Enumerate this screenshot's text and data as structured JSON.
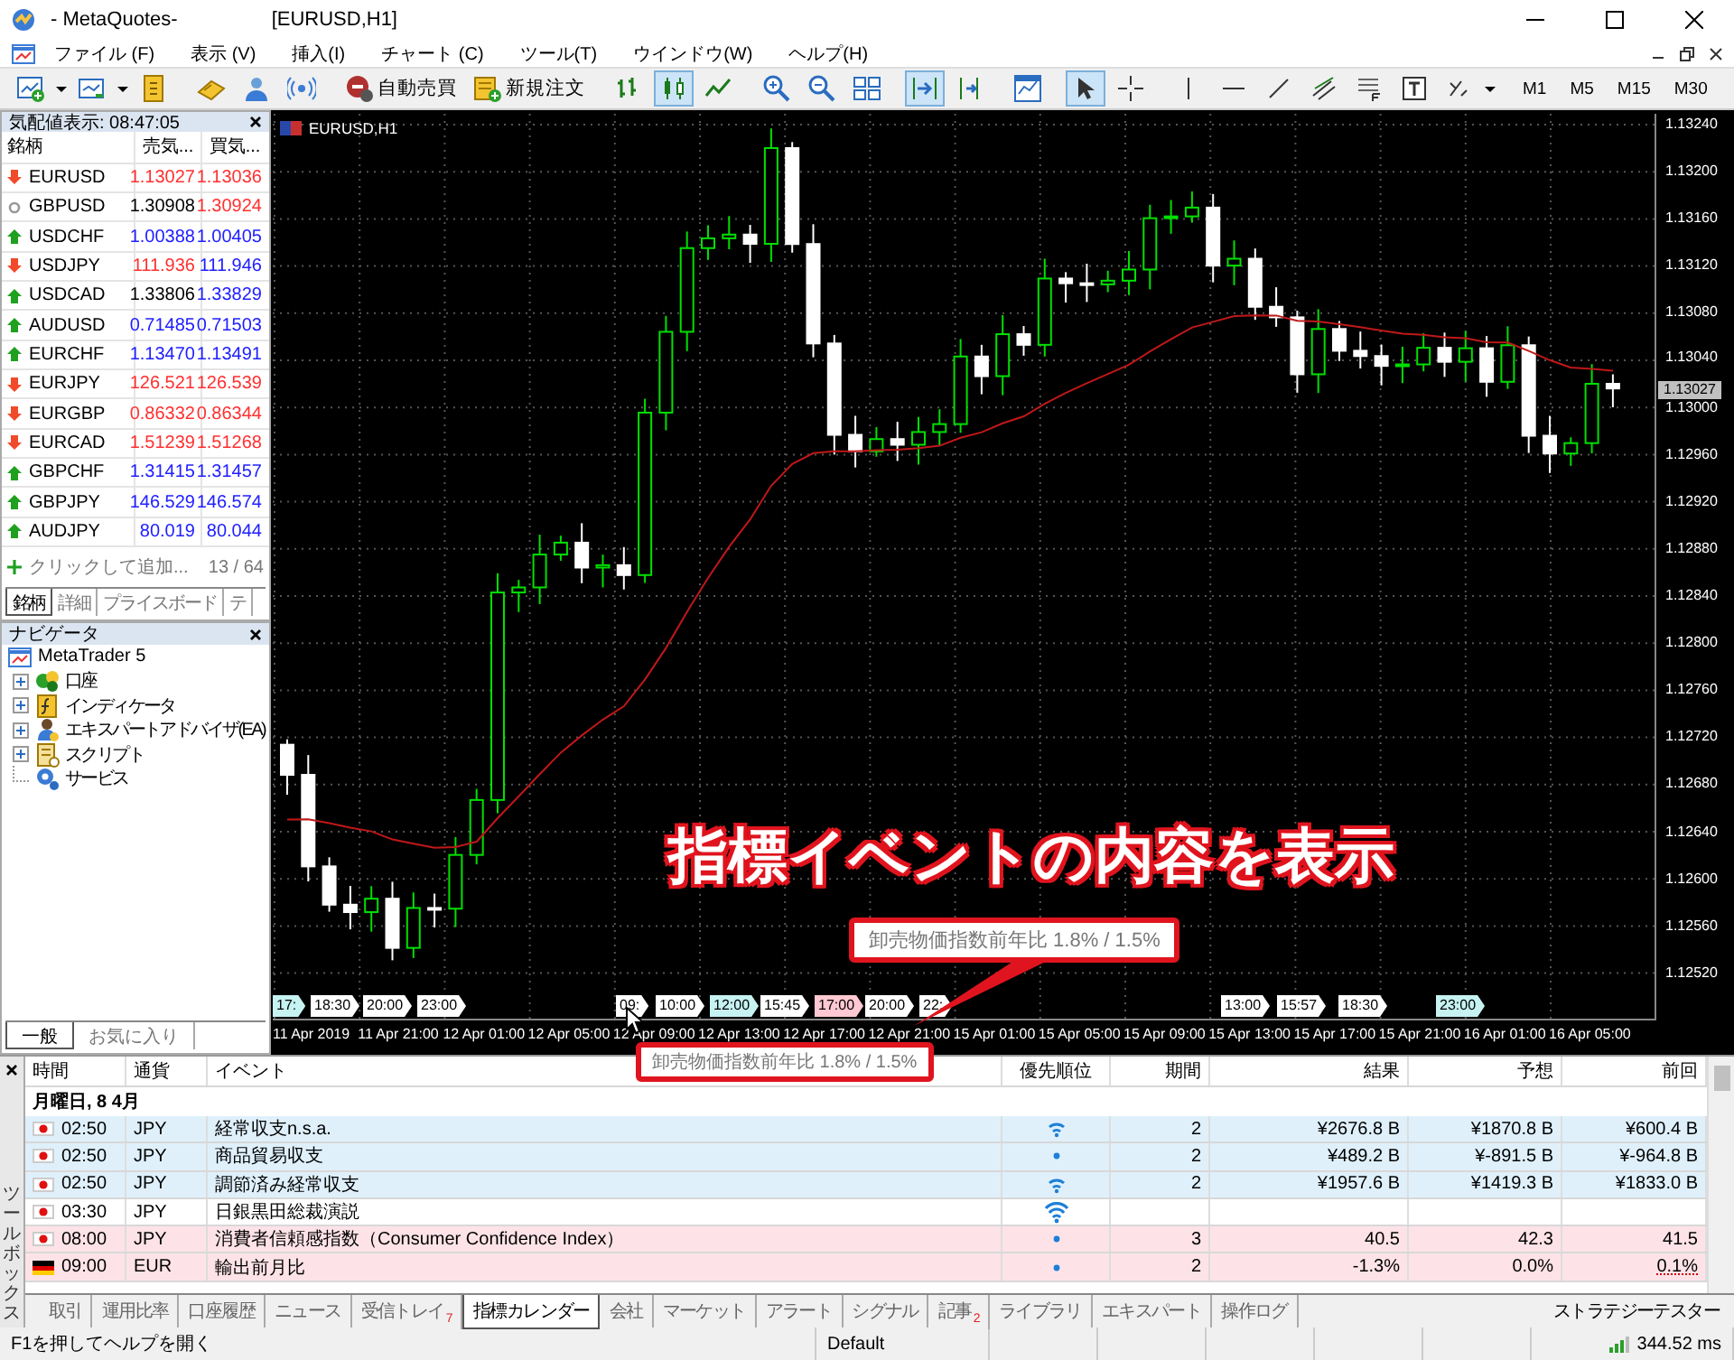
{
  "window": {
    "title": [
      "- MetaQuotes-",
      "[EURUSD,H1]"
    ]
  },
  "menu": [
    "ファイル (F)",
    "表示 (V)",
    "挿入(I)",
    "チャート (C)",
    "ツール(T)",
    "ウインドウ(W)",
    "ヘルプ(H)"
  ],
  "toolbar": {
    "auto_trading": "自動売買",
    "new_order": "新規注文",
    "chart_types": [
      {
        "selected": false
      },
      {
        "selected": true
      },
      {
        "selected": false
      }
    ],
    "autoscroll": true,
    "chart_shift": false,
    "cursor_tool": true,
    "timeframes": [
      {
        "label": "M1",
        "selected": false
      },
      {
        "label": "M5",
        "selected": false
      },
      {
        "label": "M15",
        "selected": false
      },
      {
        "label": "M30",
        "selected": false
      }
    ]
  },
  "market_watch": {
    "title": "気配値表示: 08:47:05",
    "columns": [
      "銘柄",
      "売気...",
      "買気..."
    ],
    "rows": [
      {
        "symbol": "EURUSD",
        "kind": "down",
        "bid": {
          "value": "1.13027",
          "color": "#ff3030"
        },
        "ask": {
          "value": "1.13036",
          "color": "#ff3030"
        }
      },
      {
        "symbol": "GBPUSD",
        "kind": "flat",
        "bid": {
          "value": "1.30908",
          "color": "#000000"
        },
        "ask": {
          "value": "1.30924",
          "color": "#ff3030"
        }
      },
      {
        "symbol": "USDCHF",
        "kind": "up",
        "bid": {
          "value": "1.00388",
          "color": "#2020ff"
        },
        "ask": {
          "value": "1.00405",
          "color": "#2020ff"
        }
      },
      {
        "symbol": "USDJPY",
        "kind": "down",
        "bid": {
          "value": "111.936",
          "color": "#ff3030"
        },
        "ask": {
          "value": "111.946",
          "color": "#2020ff"
        }
      },
      {
        "symbol": "USDCAD",
        "kind": "up",
        "bid": {
          "value": "1.33806",
          "color": "#000000"
        },
        "ask": {
          "value": "1.33829",
          "color": "#2020ff"
        }
      },
      {
        "symbol": "AUDUSD",
        "kind": "up",
        "bid": {
          "value": "0.71485",
          "color": "#2020ff"
        },
        "ask": {
          "value": "0.71503",
          "color": "#2020ff"
        }
      },
      {
        "symbol": "EURCHF",
        "kind": "up",
        "bid": {
          "value": "1.13470",
          "color": "#2020ff"
        },
        "ask": {
          "value": "1.13491",
          "color": "#2020ff"
        }
      },
      {
        "symbol": "EURJPY",
        "kind": "down",
        "bid": {
          "value": "126.521",
          "color": "#ff3030"
        },
        "ask": {
          "value": "126.539",
          "color": "#ff3030"
        }
      },
      {
        "symbol": "EURGBP",
        "kind": "down",
        "bid": {
          "value": "0.86332",
          "color": "#ff3030"
        },
        "ask": {
          "value": "0.86344",
          "color": "#ff3030"
        }
      },
      {
        "symbol": "EURCAD",
        "kind": "down",
        "bid": {
          "value": "1.51239",
          "color": "#ff3030"
        },
        "ask": {
          "value": "1.51268",
          "color": "#ff3030"
        }
      },
      {
        "symbol": "GBPCHF",
        "kind": "up",
        "bid": {
          "value": "1.31415",
          "color": "#2020ff"
        },
        "ask": {
          "value": "1.31457",
          "color": "#2020ff"
        }
      },
      {
        "symbol": "GBPJPY",
        "kind": "up",
        "bid": {
          "value": "146.529",
          "color": "#2020ff"
        },
        "ask": {
          "value": "146.574",
          "color": "#2020ff"
        }
      },
      {
        "symbol": "AUDJPY",
        "kind": "up",
        "bid": {
          "value": "80.019",
          "color": "#2020ff"
        },
        "ask": {
          "value": "80.044",
          "color": "#2020ff"
        }
      }
    ],
    "add_hint": "クリックして追加...",
    "count": "13 / 64",
    "tabs": [
      {
        "label": "銘柄",
        "selected": true
      },
      {
        "label": "詳細",
        "selected": false
      },
      {
        "label": "プライスボード",
        "selected": false
      },
      {
        "label": "テ",
        "selected": false
      }
    ]
  },
  "navigator": {
    "title": "ナビゲータ",
    "root": {
      "label": "MetaTrader 5",
      "children": [
        {
          "label": "口座",
          "expanded": false
        },
        {
          "label": "インディケータ",
          "expanded": false
        },
        {
          "label": "エキスパートアドバイザ(EA)",
          "expanded": false
        },
        {
          "label": "スクリプト",
          "expanded": false
        },
        {
          "label": "サービス"
        }
      ]
    },
    "tabs": [
      {
        "label": "一般",
        "selected": true
      },
      {
        "label": "お気に入り",
        "selected": false
      }
    ]
  },
  "chart": {
    "symbol": "EURUSD,H1",
    "price_labels": [
      "1.13240",
      "1.13200",
      "1.13160",
      "1.13120",
      "1.13080",
      "1.13040",
      "1.13000",
      "1.12960",
      "1.12920",
      "1.12880",
      "1.12840",
      "1.12800",
      "1.12760",
      "1.12720",
      "1.12680",
      "1.12640",
      "1.12600",
      "1.12560",
      "1.12520"
    ],
    "current_price": "1.13027",
    "time_labels": [
      "11 Apr 2019",
      "11 Apr 21:00",
      "12 Apr 01:00",
      "12 Apr 05:00",
      "12 Apr 09:00",
      "12 Apr 13:00",
      "12 Apr 17:00",
      "12 Apr 21:00",
      "15 Apr 01:00",
      "15 Apr 05:00",
      "15 Apr 09:00",
      "15 Apr 13:00",
      "15 Apr 17:00",
      "15 Apr 21:00",
      "16 Apr 01:00",
      "16 Apr 05:00"
    ],
    "events": [
      {
        "time": "17:",
        "color": "#c6f2f2"
      },
      {
        "time": "18:30",
        "color": "#ffffff"
      },
      {
        "time": "20:00",
        "color": "#ffffff"
      },
      {
        "time": "23:00",
        "color": "#ffffff"
      },
      {
        "time": "09:",
        "color": "#ffffff"
      },
      {
        "time": "10:00",
        "color": "#ffffff"
      },
      {
        "time": "12:00",
        "color": "#c6f2f2"
      },
      {
        "time": "15:45",
        "color": "#ffffff"
      },
      {
        "time": "17:00",
        "color": "#ffc8d2"
      },
      {
        "time": "20:00",
        "color": "#ffffff"
      },
      {
        "time": "22:",
        "color": "#ffffff"
      },
      {
        "time": "13:00",
        "color": "#ffffff"
      },
      {
        "time": "15:57",
        "color": "#ffffff"
      },
      {
        "time": "18:30",
        "color": "#ffffff"
      },
      {
        "time": "23:00",
        "color": "#c6f2f2"
      }
    ],
    "annotation": "指標イベントの内容を表示",
    "tooltip": "卸売物価指数前年比 1.8% / 1.5%",
    "axis_tooltip": "卸売物価指数前年比 1.8% / 1.5%"
  },
  "calendar": {
    "toolbox_label": "ツールボックス",
    "columns": [
      "時間",
      "通貨",
      "イベント",
      "優先順位",
      "期間",
      "結果",
      "予想",
      "前回"
    ],
    "group": "月曜日, 8 4月",
    "rows": [
      {
        "flag": {
          "kind": "jp"
        },
        "time": "02:50",
        "currency": "JPY",
        "event": "経常収支n.s.a.",
        "priority": {
          "kind": "medium"
        },
        "period": "2",
        "actual": "¥2676.8 B",
        "forecast": "¥1870.8 B",
        "previous": "¥600.4 B",
        "color": "#dff0fb"
      },
      {
        "flag": {
          "kind": "jp"
        },
        "time": "02:50",
        "currency": "JPY",
        "event": "商品貿易収支",
        "priority": {
          "kind": "low"
        },
        "period": "2",
        "actual": "¥489.2 B",
        "forecast": "¥-891.5 B",
        "previous": "¥-964.8 B",
        "color": "#dff0fb"
      },
      {
        "flag": {
          "kind": "jp"
        },
        "time": "02:50",
        "currency": "JPY",
        "event": "調節済み経常収支",
        "priority": {
          "kind": "medium"
        },
        "period": "2",
        "actual": "¥1957.6 B",
        "forecast": "¥1419.3 B",
        "previous": "¥1833.0 B",
        "color": "#dff0fb"
      },
      {
        "flag": {
          "kind": "jp"
        },
        "time": "03:30",
        "currency": "JPY",
        "event": "日銀黒田総裁演説",
        "priority": {
          "kind": "high"
        },
        "color": "#ffffff"
      },
      {
        "flag": {
          "kind": "jp"
        },
        "time": "08:00",
        "currency": "JPY",
        "event": "消費者信頼感指数（Consumer Confidence Index）",
        "priority": {
          "kind": "low"
        },
        "period": "3",
        "actual": "40.5",
        "forecast": "42.3",
        "previous": "41.5",
        "color": "#fde3e8"
      },
      {
        "flag": {
          "kind": "de"
        },
        "time": "09:00",
        "currency": "EUR",
        "event": "輸出前月比",
        "priority": {
          "kind": "low"
        },
        "period": "2",
        "actual": "-1.3%",
        "forecast": "0.0%",
        "previous": "0.1%",
        "previous_revised": true,
        "color": "#fde3e8"
      }
    ],
    "tabs": [
      {
        "label": "取引",
        "selected": false
      },
      {
        "label": "運用比率",
        "selected": false
      },
      {
        "label": "口座履歴",
        "selected": false
      },
      {
        "label": "ニュース",
        "selected": false
      },
      {
        "label": "受信トレイ",
        "badge": "7",
        "selected": false
      },
      {
        "label": "指標カレンダー",
        "selected": true
      },
      {
        "label": "会社",
        "selected": false
      },
      {
        "label": "マーケット",
        "selected": false
      },
      {
        "label": "アラート",
        "selected": false
      },
      {
        "label": "シグナル",
        "selected": false
      },
      {
        "label": "記事",
        "badge": "2",
        "selected": false
      },
      {
        "label": "ライブラリ",
        "selected": false
      },
      {
        "label": "エキスパート",
        "selected": false
      },
      {
        "label": "操作ログ",
        "selected": false
      }
    ],
    "tester": "ストラテジーテスター"
  },
  "status_bar": {
    "help": "F1を押してヘルプを開く",
    "profile": "Default",
    "ping": "344.52 ms"
  }
}
